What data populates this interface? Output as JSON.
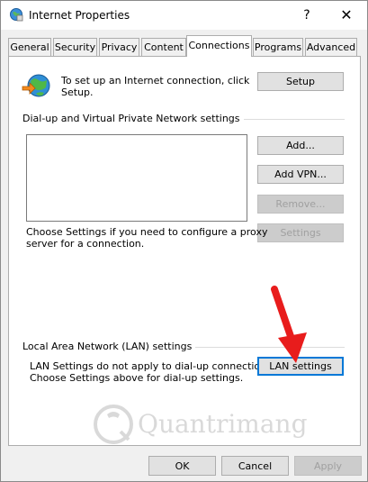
{
  "window": {
    "title": "Internet Properties",
    "help_glyph": "?",
    "close_glyph": "✕"
  },
  "tabs": [
    {
      "label": "General",
      "active": false
    },
    {
      "label": "Security",
      "active": false
    },
    {
      "label": "Privacy",
      "active": false
    },
    {
      "label": "Content",
      "active": false
    },
    {
      "label": "Connections",
      "active": true
    },
    {
      "label": "Programs",
      "active": false
    },
    {
      "label": "Advanced",
      "active": false
    }
  ],
  "setup": {
    "line1": "To set up an Internet connection, click",
    "line2": "Setup.",
    "button": "Setup"
  },
  "dialup": {
    "heading": "Dial-up and Virtual Private Network settings",
    "add_button": "Add...",
    "add_vpn_button": "Add VPN...",
    "remove_button": "Remove...",
    "settings_button": "Settings",
    "proxy_line1": "Choose Settings if you need to configure a proxy",
    "proxy_line2": "server for a connection."
  },
  "lan": {
    "heading": "Local Area Network (LAN) settings",
    "line1": "LAN Settings do not apply to dial-up connections.",
    "line2": "Choose Settings above for dial-up settings.",
    "button": "LAN settings"
  },
  "footer": {
    "ok": "OK",
    "cancel": "Cancel",
    "apply": "Apply"
  },
  "watermark": {
    "text": "Quantrimang"
  },
  "colors": {
    "accent": "#0078d7",
    "arrow": "#e81c1c",
    "disabled_text": "#a0a0a0"
  }
}
